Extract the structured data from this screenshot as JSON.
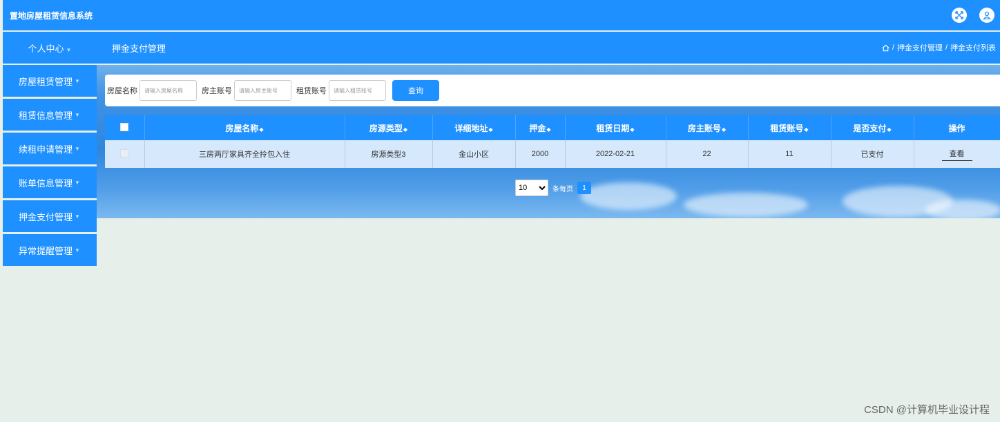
{
  "header": {
    "title": "置地房屋租赁信息系统",
    "icons": [
      "fullscreen-icon",
      "user-icon"
    ]
  },
  "subbar": {
    "personal_center": "个人中心",
    "page_title": "押金支付管理",
    "breadcrumb": {
      "home_icon": "home-icon",
      "level1": "押金支付管理",
      "level2": "押金支付列表"
    }
  },
  "sidebar": {
    "items": [
      {
        "label": "房屋租赁管理"
      },
      {
        "label": "租赁信息管理"
      },
      {
        "label": "续租申请管理"
      },
      {
        "label": "账单信息管理"
      },
      {
        "label": "押金支付管理"
      },
      {
        "label": "异常提醒管理"
      }
    ]
  },
  "search": {
    "house_name_label": "房屋名称",
    "house_name_placeholder": "请输入房屋名称",
    "owner_label": "房主账号",
    "owner_placeholder": "请输入房主账号",
    "renter_label": "租赁账号",
    "renter_placeholder": "请输入租赁账号",
    "button": "查询"
  },
  "table": {
    "columns": [
      "房屋名称",
      "房源类型",
      "详细地址",
      "押金",
      "租赁日期",
      "房主账号",
      "租赁账号",
      "是否支付",
      "操作"
    ],
    "rows": [
      {
        "house_name": "三房两厅家具齐全拎包入住",
        "type": "房源类型3",
        "address": "金山小区",
        "deposit": "2000",
        "date": "2022-02-21",
        "owner": "22",
        "renter": "11",
        "paid": "已支付",
        "action": "查看"
      }
    ]
  },
  "pagination": {
    "page_size": "10",
    "per_page_label": "条每页",
    "current_page": "1"
  },
  "watermark": "CSDN @计算机毕业设计程",
  "colors": {
    "primary": "#1e90ff",
    "background": "#e6efe9"
  }
}
